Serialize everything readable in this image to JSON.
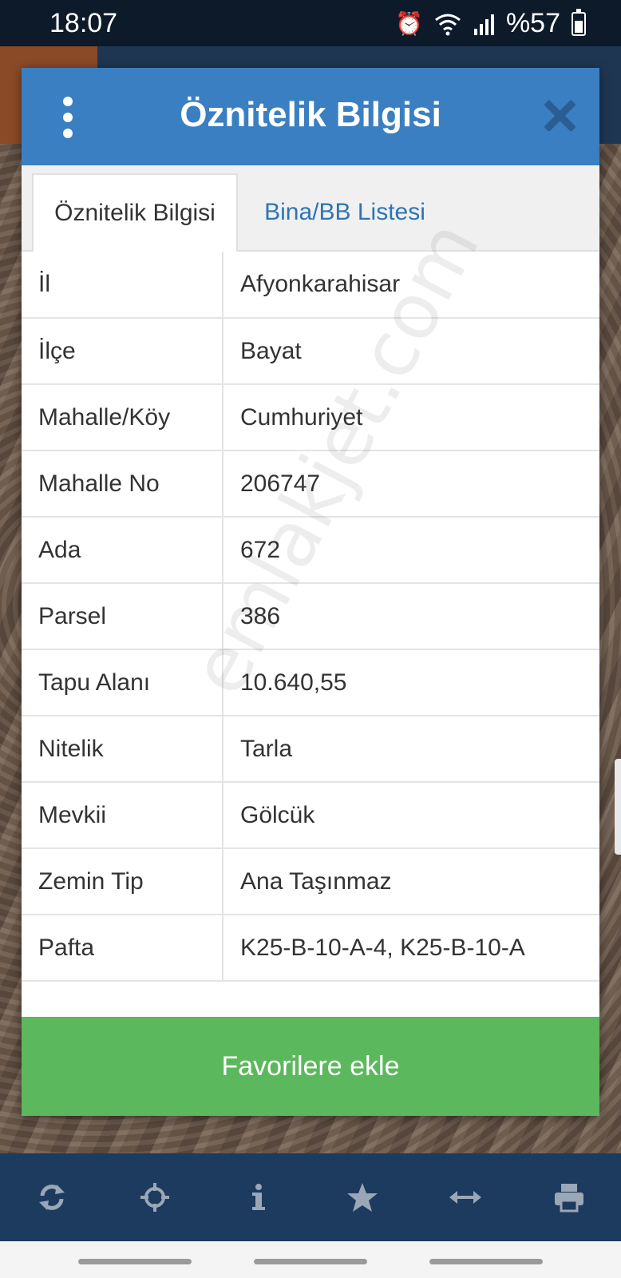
{
  "status_bar": {
    "time": "18:07",
    "battery": "%57",
    "battery_level": 0.57
  },
  "modal": {
    "title": "Öznitelik Bilgisi",
    "tabs": [
      {
        "label": "Öznitelik Bilgisi",
        "active": true
      },
      {
        "label": "Bina/BB Listesi",
        "active": false
      }
    ],
    "rows": [
      {
        "key": "İl",
        "value": "Afyonkarahisar"
      },
      {
        "key": "İlçe",
        "value": "Bayat"
      },
      {
        "key": "Mahalle/Köy",
        "value": "Cumhuriyet"
      },
      {
        "key": "Mahalle No",
        "value": "206747"
      },
      {
        "key": "Ada",
        "value": "672"
      },
      {
        "key": "Parsel",
        "value": "386"
      },
      {
        "key": "Tapu Alanı",
        "value": "10.640,55"
      },
      {
        "key": "Nitelik",
        "value": "Tarla"
      },
      {
        "key": "Mevkii",
        "value": "Gölcük"
      },
      {
        "key": "Zemin Tip",
        "value": "Ana Taşınmaz"
      },
      {
        "key": "Pafta",
        "value": "K25-B-10-A-4, K25-B-10-A"
      }
    ],
    "favorite_label": "Favorilere ekle",
    "watermark": "emlakjet.com"
  },
  "toolbar": {
    "icons": [
      "refresh-icon",
      "crosshair-icon",
      "info-icon",
      "star-icon",
      "arrows-horizontal-icon",
      "printer-icon"
    ]
  },
  "colors": {
    "header_blue": "#3a7fc1",
    "tab_link_blue": "#2e74b5",
    "favorite_green": "#5cb85c",
    "toolbar_navy": "#1d3a5f"
  }
}
